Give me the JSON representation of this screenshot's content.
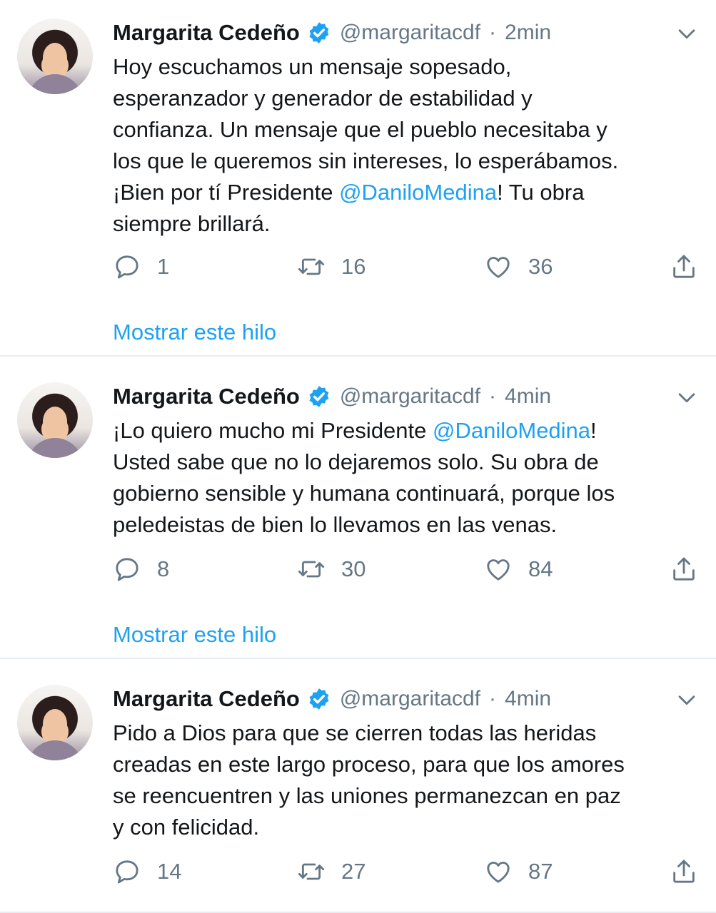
{
  "colors": {
    "link": "#1da1f2",
    "muted": "#657786",
    "text": "#14171a",
    "divider": "#e6ecf0"
  },
  "tweets": [
    {
      "name": "Margarita Cedeño",
      "handle": "@margaritacdf",
      "separator": "·",
      "time": "2min",
      "text_before": "Hoy escuchamos un mensaje sopesado,\nesperanzador y generador de estabilidad y\nconfianza. Un mensaje que el pueblo necesitaba y\nlos que le queremos sin intereses, lo esperábamos.\n¡Bien por tí Presidente ",
      "mention": "@DaniloMedina",
      "text_after": "! Tu obra\nsiempre brillará.",
      "replies": "1",
      "retweets": "16",
      "likes": "36",
      "show_thread": "Mostrar este hilo"
    },
    {
      "name": "Margarita Cedeño",
      "handle": "@margaritacdf",
      "separator": "·",
      "time": "4min",
      "text_before": "¡Lo quiero mucho mi Presidente ",
      "mention": "@DaniloMedina",
      "text_after": "!\nUsted sabe que no lo dejaremos solo. Su obra de\ngobierno sensible y humana continuará, porque los\npeledeistas de bien lo llevamos en las venas.",
      "replies": "8",
      "retweets": "30",
      "likes": "84",
      "show_thread": "Mostrar este hilo"
    },
    {
      "name": "Margarita Cedeño",
      "handle": "@margaritacdf",
      "separator": "·",
      "time": "4min",
      "text_before": "Pido a Dios para que se cierren todas las heridas\ncreadas en este largo proceso, para que los amores\nse reencuentren y las uniones permanezcan en paz\ny con felicidad.",
      "mention": "",
      "text_after": "",
      "replies": "14",
      "retweets": "27",
      "likes": "87",
      "show_thread": ""
    }
  ]
}
